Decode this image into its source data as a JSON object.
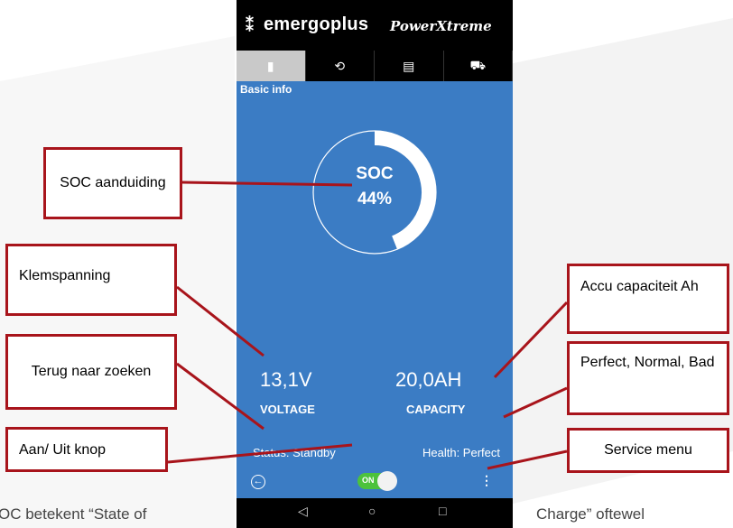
{
  "header": {
    "logo_mark": "⁑",
    "app_brand": "emergoplus",
    "product_brand": "PowerXtreme"
  },
  "tabs": [
    {
      "icon": "battery-icon",
      "glyph": "🔋"
    },
    {
      "icon": "gauge-icon",
      "glyph": "⟲"
    },
    {
      "icon": "document-icon",
      "glyph": "🗎"
    },
    {
      "icon": "cart-icon",
      "glyph": "🛒"
    }
  ],
  "screen": {
    "section_label": "Basic info",
    "soc_label": "SOC",
    "soc_value": "44%",
    "soc_fraction": 0.44,
    "voltage_value": "13,1V",
    "voltage_label": "VOLTAGE",
    "capacity_value": "20,0AH",
    "capacity_label": "CAPACITY",
    "status_text": "Status: Standby",
    "health_text": "Health: Perfect",
    "toggle_label": "ON",
    "menu_glyph": "⋮",
    "back_glyph": "←"
  },
  "navbar": {
    "back": "◁",
    "home": "○",
    "recents": "□"
  },
  "callouts": {
    "soc": "SOC aanduiding",
    "voltage": "Klemspanning",
    "back": "Terug naar zoeken",
    "toggle": "Aan/ Uit knop",
    "capacity": "Accu capaciteit Ah",
    "health": "Perfect, Normal, Bad",
    "service": "Service menu"
  },
  "footer": {
    "left": "OC betekent “State of",
    "right": "Charge”   oftewel"
  },
  "colors": {
    "screen_blue": "#3b7cc4",
    "callout_border": "#a8141b",
    "toggle_green": "#4cc23c"
  }
}
